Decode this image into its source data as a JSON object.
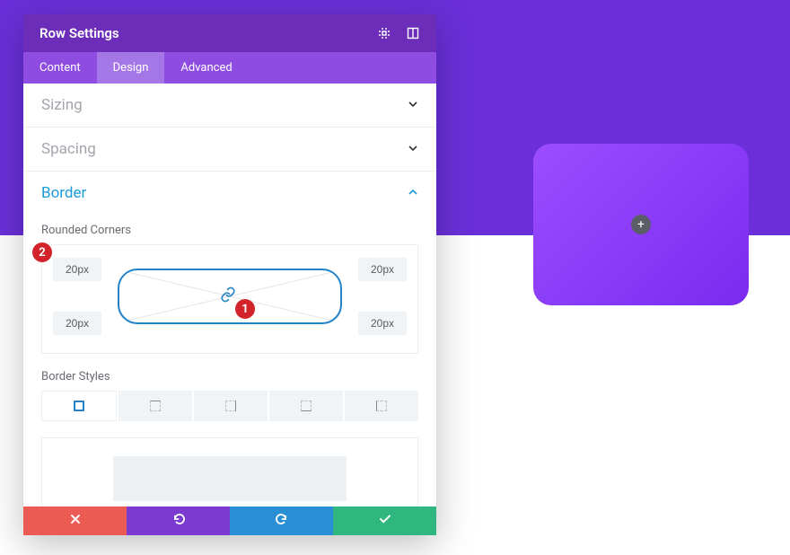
{
  "header": {
    "title": "Row Settings",
    "icons": [
      "crosshair-icon",
      "columns-icon"
    ]
  },
  "tabs": [
    {
      "label": "Content",
      "active": false
    },
    {
      "label": "Design",
      "active": true
    },
    {
      "label": "Advanced",
      "active": false
    }
  ],
  "sections": {
    "sizing": {
      "title": "Sizing",
      "expanded": false
    },
    "spacing": {
      "title": "Spacing",
      "expanded": false
    },
    "border": {
      "title": "Border",
      "expanded": true
    }
  },
  "border": {
    "rounded_label": "Rounded Corners",
    "corners": {
      "tl": "20px",
      "tr": "20px",
      "bl": "20px",
      "br": "20px"
    },
    "link_values": true,
    "styles_label": "Border Styles",
    "style_options": [
      "all",
      "top",
      "right",
      "bottom",
      "left"
    ],
    "selected_style_index": 0
  },
  "markers": {
    "one": "1",
    "two": "2"
  },
  "footer": {
    "cancel_icon": "close-icon",
    "undo_icon": "undo-icon",
    "redo_icon": "redo-icon",
    "save_icon": "check-icon"
  },
  "preview": {
    "add_label": "+",
    "corner_radius_px": 20,
    "gradient": [
      "#9b4dff",
      "#7a2bef"
    ]
  },
  "colors": {
    "brand_purple": "#6c2eb9",
    "tab_purple": "#8e4ce0",
    "accent_blue": "#2284c6",
    "danger_red": "#eb5a53",
    "success": "#2fb77f",
    "marker_red": "#d2232a"
  }
}
